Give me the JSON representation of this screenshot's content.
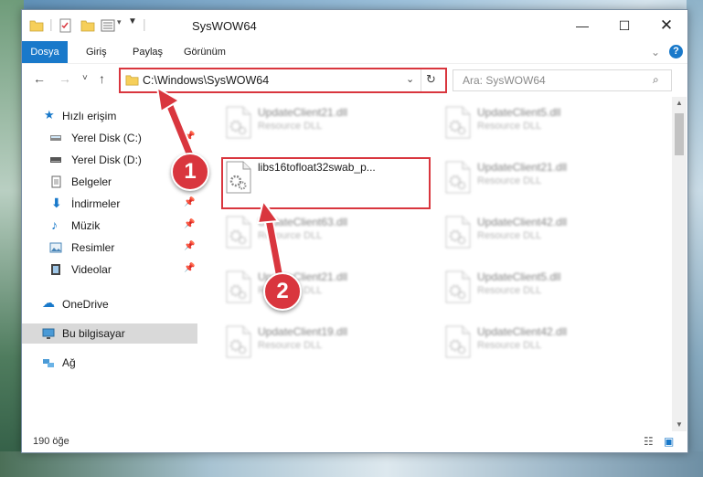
{
  "window": {
    "title": "SysWOW64"
  },
  "ribbon": {
    "tabs": [
      "Dosya",
      "Giriş",
      "Paylaş",
      "Görünüm"
    ]
  },
  "address": {
    "path": "C:\\Windows\\SysWOW64"
  },
  "search": {
    "placeholder": "Ara: SysWOW64"
  },
  "sidebar": {
    "quick_access": "Hızlı erişim",
    "items": [
      {
        "label": "Yerel Disk (C:)",
        "icon": "drive-icon",
        "pinned": true
      },
      {
        "label": "Yerel Disk (D:)",
        "icon": "drive-icon",
        "pinned": false
      },
      {
        "label": "Belgeler",
        "icon": "documents-icon",
        "pinned": true
      },
      {
        "label": "İndirmeler",
        "icon": "download-icon",
        "pinned": true
      },
      {
        "label": "Müzik",
        "icon": "music-icon",
        "pinned": true
      },
      {
        "label": "Resimler",
        "icon": "pictures-icon",
        "pinned": true
      },
      {
        "label": "Videolar",
        "icon": "videos-icon",
        "pinned": true
      }
    ],
    "onedrive": "OneDrive",
    "this_pc": "Bu bilgisayar",
    "network": "Ağ"
  },
  "files": [
    {
      "name": "UpdateClient21.dll",
      "type": "Resource DLL"
    },
    {
      "name": "UpdateClient5.dll",
      "type": "Resource DLL"
    },
    {
      "name": "libs16tofloat32swab_p...",
      "type": ""
    },
    {
      "name": "UpdateClient21.dll",
      "type": "Resource DLL"
    },
    {
      "name": "UpdateClient63.dll",
      "type": "Resource DLL"
    },
    {
      "name": "UpdateClient42.dll",
      "type": "Resource DLL"
    },
    {
      "name": "UpdateClient21.dll",
      "type": "Resource DLL"
    },
    {
      "name": "UpdateClient5.dll",
      "type": "Resource DLL"
    },
    {
      "name": "UpdateClient19.dll",
      "type": "Resource DLL"
    },
    {
      "name": "UpdateClient42.dll",
      "type": "Resource DLL"
    }
  ],
  "status": {
    "count": "190 öğe"
  },
  "callouts": [
    "1",
    "2"
  ],
  "colors": {
    "accent": "#1979ca",
    "highlight": "#d9363e"
  }
}
